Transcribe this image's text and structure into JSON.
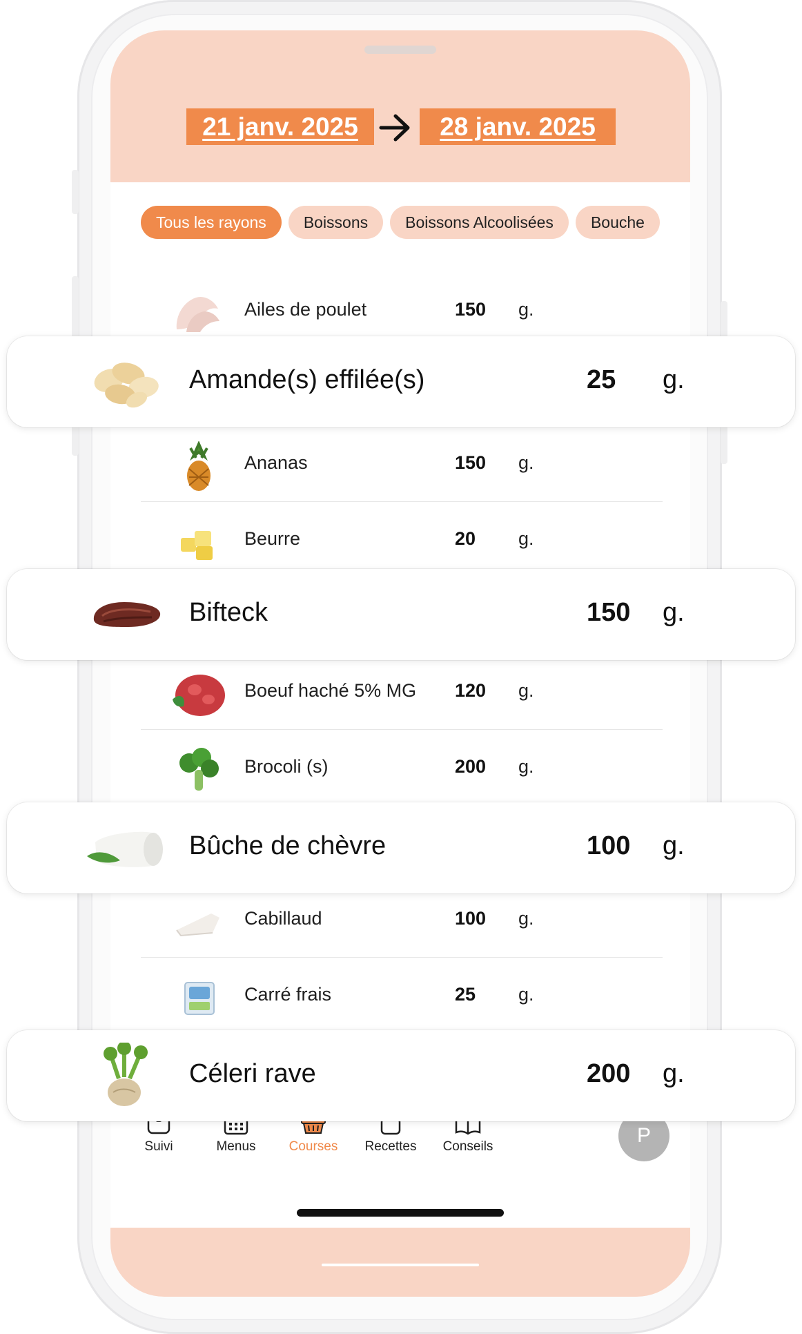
{
  "header": {
    "start_date": "21 janv. 2025",
    "end_date": "28 janv. 2025"
  },
  "categories": [
    {
      "label": "Tous les rayons",
      "active": true
    },
    {
      "label": "Boissons",
      "active": false
    },
    {
      "label": "Boissons Alcoolisées",
      "active": false
    },
    {
      "label": "Bouche",
      "active": false
    }
  ],
  "items": [
    {
      "name": "Ailes de poulet",
      "qty": "150",
      "unit": "g.",
      "icon": "chicken-wings-icon"
    },
    {
      "name": "Amande(s) effilée(s)",
      "qty": "25",
      "unit": "g.",
      "icon": "sliced-almonds-icon"
    },
    {
      "name": "Ananas",
      "qty": "150",
      "unit": "g.",
      "icon": "pineapple-icon"
    },
    {
      "name": "Beurre",
      "qty": "20",
      "unit": "g.",
      "icon": "butter-icon"
    },
    {
      "name": "Bifteck",
      "qty": "150",
      "unit": "g.",
      "icon": "steak-icon"
    },
    {
      "name": "Boeuf haché 5% MG",
      "qty": "120",
      "unit": "g.",
      "icon": "ground-beef-icon"
    },
    {
      "name": "Brocoli (s)",
      "qty": "200",
      "unit": "g.",
      "icon": "broccoli-icon"
    },
    {
      "name": "Bûche de chèvre",
      "qty": "100",
      "unit": "g.",
      "icon": "goat-cheese-log-icon"
    },
    {
      "name": "Cabillaud",
      "qty": "100",
      "unit": "g.",
      "icon": "cod-fillet-icon"
    },
    {
      "name": "Carré frais",
      "qty": "25",
      "unit": "g.",
      "icon": "fresh-cheese-icon"
    },
    {
      "name": "Céleri rave",
      "qty": "200",
      "unit": "g.",
      "icon": "celeriac-icon"
    }
  ],
  "nav": [
    {
      "label": "Suivi",
      "icon": "scale-icon",
      "active": false
    },
    {
      "label": "Menus",
      "icon": "calendar-icon",
      "active": false
    },
    {
      "label": "Courses",
      "icon": "basket-icon",
      "active": true
    },
    {
      "label": "Recettes",
      "icon": "pot-icon",
      "active": false
    },
    {
      "label": "Conseils",
      "icon": "book-icon",
      "active": false
    }
  ],
  "avatar_initial": "P",
  "colors": {
    "accent": "#f08a4b",
    "peach": "#f9d5c5",
    "avatar": "#b4b4b4"
  }
}
